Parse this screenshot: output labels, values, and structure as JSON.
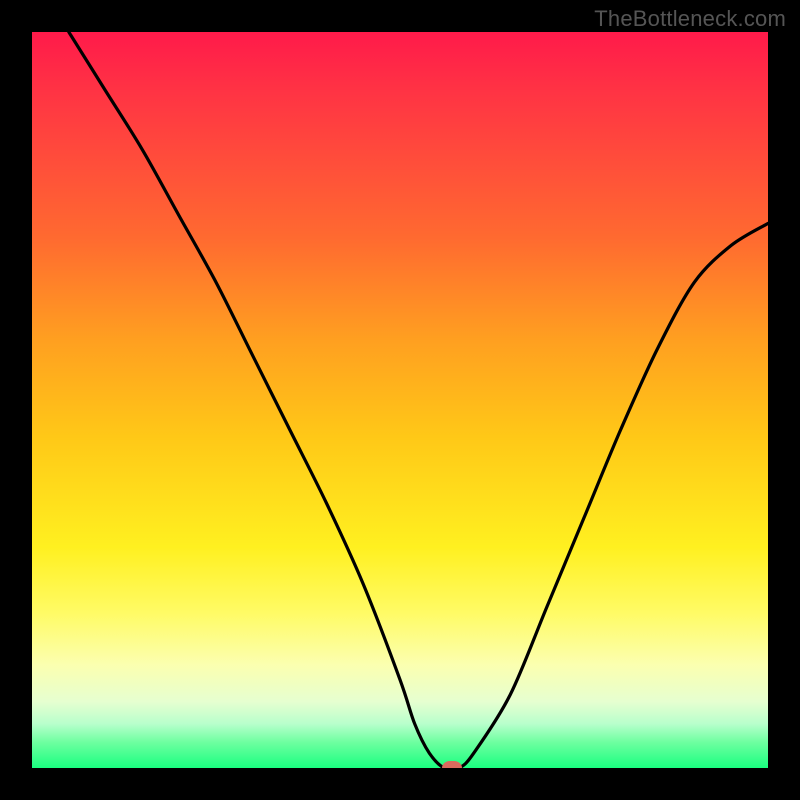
{
  "watermark": "TheBottleneck.com",
  "chart_data": {
    "type": "line",
    "title": "",
    "xlabel": "",
    "ylabel": "",
    "xlim": [
      0,
      100
    ],
    "ylim": [
      0,
      100
    ],
    "grid": false,
    "legend": false,
    "series": [
      {
        "name": "bottleneck-curve",
        "x": [
          5,
          10,
          15,
          20,
          25,
          30,
          35,
          40,
          45,
          50,
          52,
          54,
          56,
          58,
          60,
          65,
          70,
          75,
          80,
          85,
          90,
          95,
          100
        ],
        "y": [
          100,
          92,
          84,
          75,
          66,
          56,
          46,
          36,
          25,
          12,
          6,
          2,
          0,
          0,
          2,
          10,
          22,
          34,
          46,
          57,
          66,
          71,
          74
        ]
      }
    ],
    "marker": {
      "x": 57,
      "y": 0
    },
    "background_gradient": {
      "type": "vertical",
      "stops": [
        {
          "pos": 0.0,
          "color": "#ff1a4a"
        },
        {
          "pos": 0.28,
          "color": "#ff6a30"
        },
        {
          "pos": 0.55,
          "color": "#ffc817"
        },
        {
          "pos": 0.79,
          "color": "#fffb66"
        },
        {
          "pos": 0.91,
          "color": "#e6ffd0"
        },
        {
          "pos": 1.0,
          "color": "#1aff80"
        }
      ]
    }
  }
}
